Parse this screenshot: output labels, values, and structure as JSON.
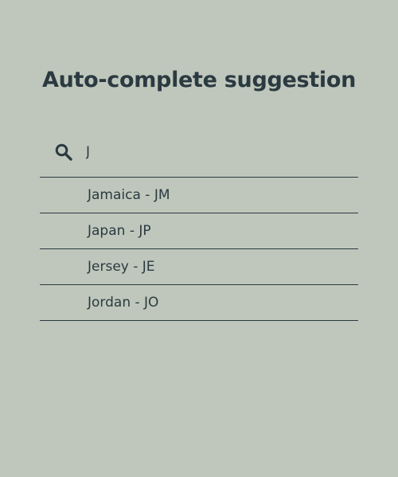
{
  "page": {
    "title": "Auto-complete suggestion"
  },
  "search": {
    "value": "J",
    "placeholder": "",
    "icon": "search-icon"
  },
  "suggestions": [
    {
      "label": "Jamaica - JM"
    },
    {
      "label": "Japan - JP"
    },
    {
      "label": "Jersey - JE"
    },
    {
      "label": "Jordan - JO"
    }
  ],
  "colors": {
    "background": "#bfc7bc",
    "text": "#2b3a41"
  }
}
